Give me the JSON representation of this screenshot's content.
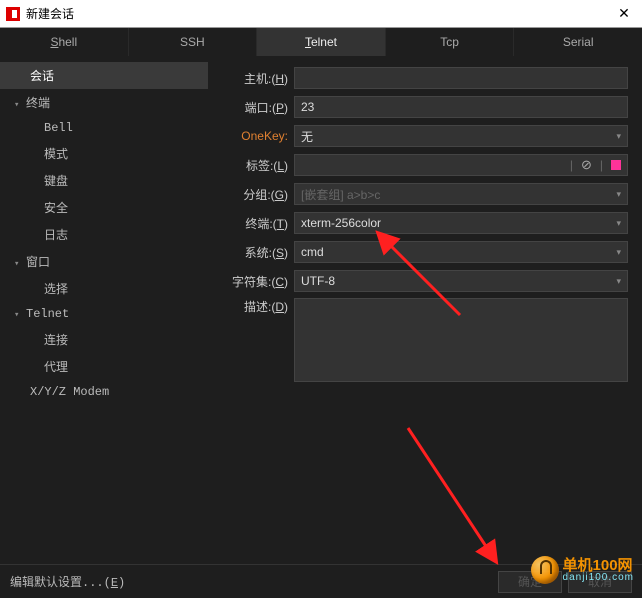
{
  "window": {
    "title": "新建会话"
  },
  "tabs": [
    {
      "label": "Shell",
      "hotkey": "S"
    },
    {
      "label": "SSH"
    },
    {
      "label": "Telnet",
      "hotkey": "T",
      "active": true
    },
    {
      "label": "Tcp"
    },
    {
      "label": "Serial"
    }
  ],
  "sidebar": {
    "items": [
      {
        "label": "会话",
        "type": "item",
        "selected": true
      },
      {
        "label": "终端",
        "type": "group"
      },
      {
        "label": "Bell",
        "type": "child"
      },
      {
        "label": "模式",
        "type": "child"
      },
      {
        "label": "键盘",
        "type": "child"
      },
      {
        "label": "安全",
        "type": "child"
      },
      {
        "label": "日志",
        "type": "child"
      },
      {
        "label": "窗口",
        "type": "group"
      },
      {
        "label": "选择",
        "type": "child"
      },
      {
        "label": "Telnet",
        "type": "group"
      },
      {
        "label": "连接",
        "type": "child"
      },
      {
        "label": "代理",
        "type": "child"
      },
      {
        "label": "X/Y/Z Modem",
        "type": "item-plain"
      }
    ]
  },
  "form": {
    "host": {
      "label": "主机:(",
      "hotkey": "H",
      "suffix": ")",
      "value": ""
    },
    "port": {
      "label": "端口:(",
      "hotkey": "P",
      "suffix": ")",
      "value": "23"
    },
    "onekey": {
      "label": "OneKey:",
      "value": "无"
    },
    "tag": {
      "label": "标签:(",
      "hotkey": "L",
      "suffix": ")",
      "value": "",
      "color": "#ff3399"
    },
    "group": {
      "label": "分组:(",
      "hotkey": "G",
      "suffix": ")",
      "placeholder": "[嵌套组] a>b>c"
    },
    "term": {
      "label": "终端:(",
      "hotkey": "T",
      "suffix": ")",
      "value": "xterm-256color"
    },
    "system": {
      "label": "系统:(",
      "hotkey": "S",
      "suffix": ")",
      "value": "cmd"
    },
    "charset": {
      "label": "字符集:(",
      "hotkey": "C",
      "suffix": ")",
      "value": "UTF-8"
    },
    "desc": {
      "label": "描述:(",
      "hotkey": "D",
      "suffix": ")"
    }
  },
  "footer": {
    "defaults_pre": "编辑默认设置...(",
    "defaults_hot": "E",
    "defaults_suf": ")",
    "ok": "确定",
    "cancel": "取消"
  },
  "watermark": {
    "line1": "单机100网",
    "line2": "danji100.com"
  }
}
